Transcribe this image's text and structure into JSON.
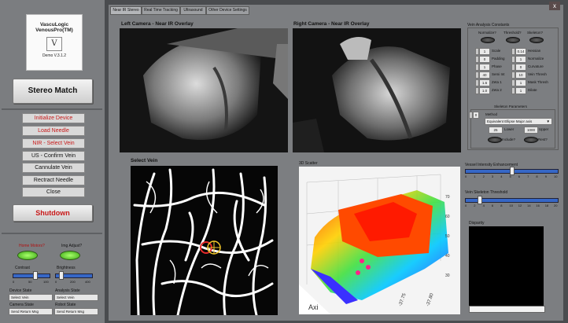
{
  "left_panel": {
    "logo": {
      "line1": "VascuLogic",
      "line2": "VenousPro(TM)",
      "mark": "V",
      "version": "Demo V.3.1.2"
    },
    "stereo_button": "Stereo Match",
    "buttons": [
      {
        "label": "Initialize Device",
        "style": "red"
      },
      {
        "label": "Load Needle",
        "style": "red"
      },
      {
        "label": "NIR - Select Vein",
        "style": "red"
      },
      {
        "label": "US - Confirm Vein",
        "style": "normal"
      },
      {
        "label": "Cannulate Vein",
        "style": "normal"
      },
      {
        "label": "Rectract Needle",
        "style": "normal"
      },
      {
        "label": "Close",
        "style": "normal"
      }
    ],
    "shutdown_button": "Shutdown",
    "home_motors": "Home Motors?",
    "img_adjust": "Img Adjust?",
    "contrast": {
      "label": "Contrast",
      "ticks": [
        "0",
        "50",
        "100"
      ],
      "value": 0.6
    },
    "brightness": {
      "label": "Brightness",
      "ticks": [
        "0",
        "200",
        "400"
      ],
      "value": 0.15
    },
    "device_state": {
      "label": "Device State",
      "value": "Select Vein"
    },
    "analysis_state": {
      "label": "Analysis State",
      "value": "Select Vein"
    },
    "camera_state": {
      "label": "Camera State",
      "value": "Send Return Msg"
    },
    "robot_state": {
      "label": "Robot State",
      "value": "Send Return Msg"
    }
  },
  "tabs": [
    "Near IR Stereo",
    "Real Time Tracking",
    "Ultrasound",
    "Other Device Settings"
  ],
  "active_tab": 0,
  "close_glyph": "x",
  "panels": {
    "left_camera": "Left Camera - Near IR Overlay",
    "right_camera": "Right Camera - Near IR Overlay",
    "select_vein": "Select Vein",
    "scatter_3d": "3D Scatter"
  },
  "constants": {
    "title": "Vein Analysis Constants",
    "toggles": [
      "Normalize?",
      "Threshold?",
      "Skeleton?"
    ],
    "left_fields": [
      {
        "value": "1",
        "label": "Scale"
      },
      {
        "value": "0",
        "label": "Padding"
      },
      {
        "value": "1",
        "label": "Phase"
      },
      {
        "value": "40",
        "label": "Semi Int"
      },
      {
        "value": "1.6",
        "label": "Zeta 1"
      },
      {
        "value": "1.0",
        "label": "Zeta 2"
      }
    ],
    "right_fields": [
      {
        "value": "0.14",
        "label": "Hessian"
      },
      {
        "value": "1",
        "label": "Normalize"
      },
      {
        "value": "0",
        "label": "Curvature"
      },
      {
        "value": "10",
        "label": "Vein Thresh"
      },
      {
        "value": "1",
        "label": "Mask Thresh"
      },
      {
        "value": "1",
        "label": "Dilate"
      }
    ],
    "skeleton_title": "Skeleton Parameters",
    "skeleton_num": "0",
    "method_label": "Method",
    "method_value": "Equivalent Ellipse Major axis",
    "lower": {
      "value": "25",
      "label": "Lower"
    },
    "upper": {
      "value": "1000",
      "label": "Upper"
    },
    "include": "Include?",
    "rest": "Rest?"
  },
  "vessel_slider": {
    "label": "Vessel Intensity Enhancement",
    "ticks": [
      "0",
      "1",
      "2",
      "3",
      "4",
      "5",
      "6",
      "7",
      "8",
      "9",
      "10"
    ],
    "value": 0.5
  },
  "skeleton_slider": {
    "label": "Vein Skeleton Threshold",
    "ticks": [
      "0",
      "2",
      "4",
      "6",
      "8",
      "10",
      "12",
      "14",
      "16",
      "18",
      "20"
    ],
    "value": 0.15
  },
  "disparity": {
    "label": "Disparity"
  },
  "scatter_axis": {
    "z_ticks": [
      "30",
      "40",
      "50",
      "60",
      "70"
    ],
    "y_ticks": [
      "-37.75",
      "-37.80"
    ],
    "axis_text": "Axi"
  }
}
